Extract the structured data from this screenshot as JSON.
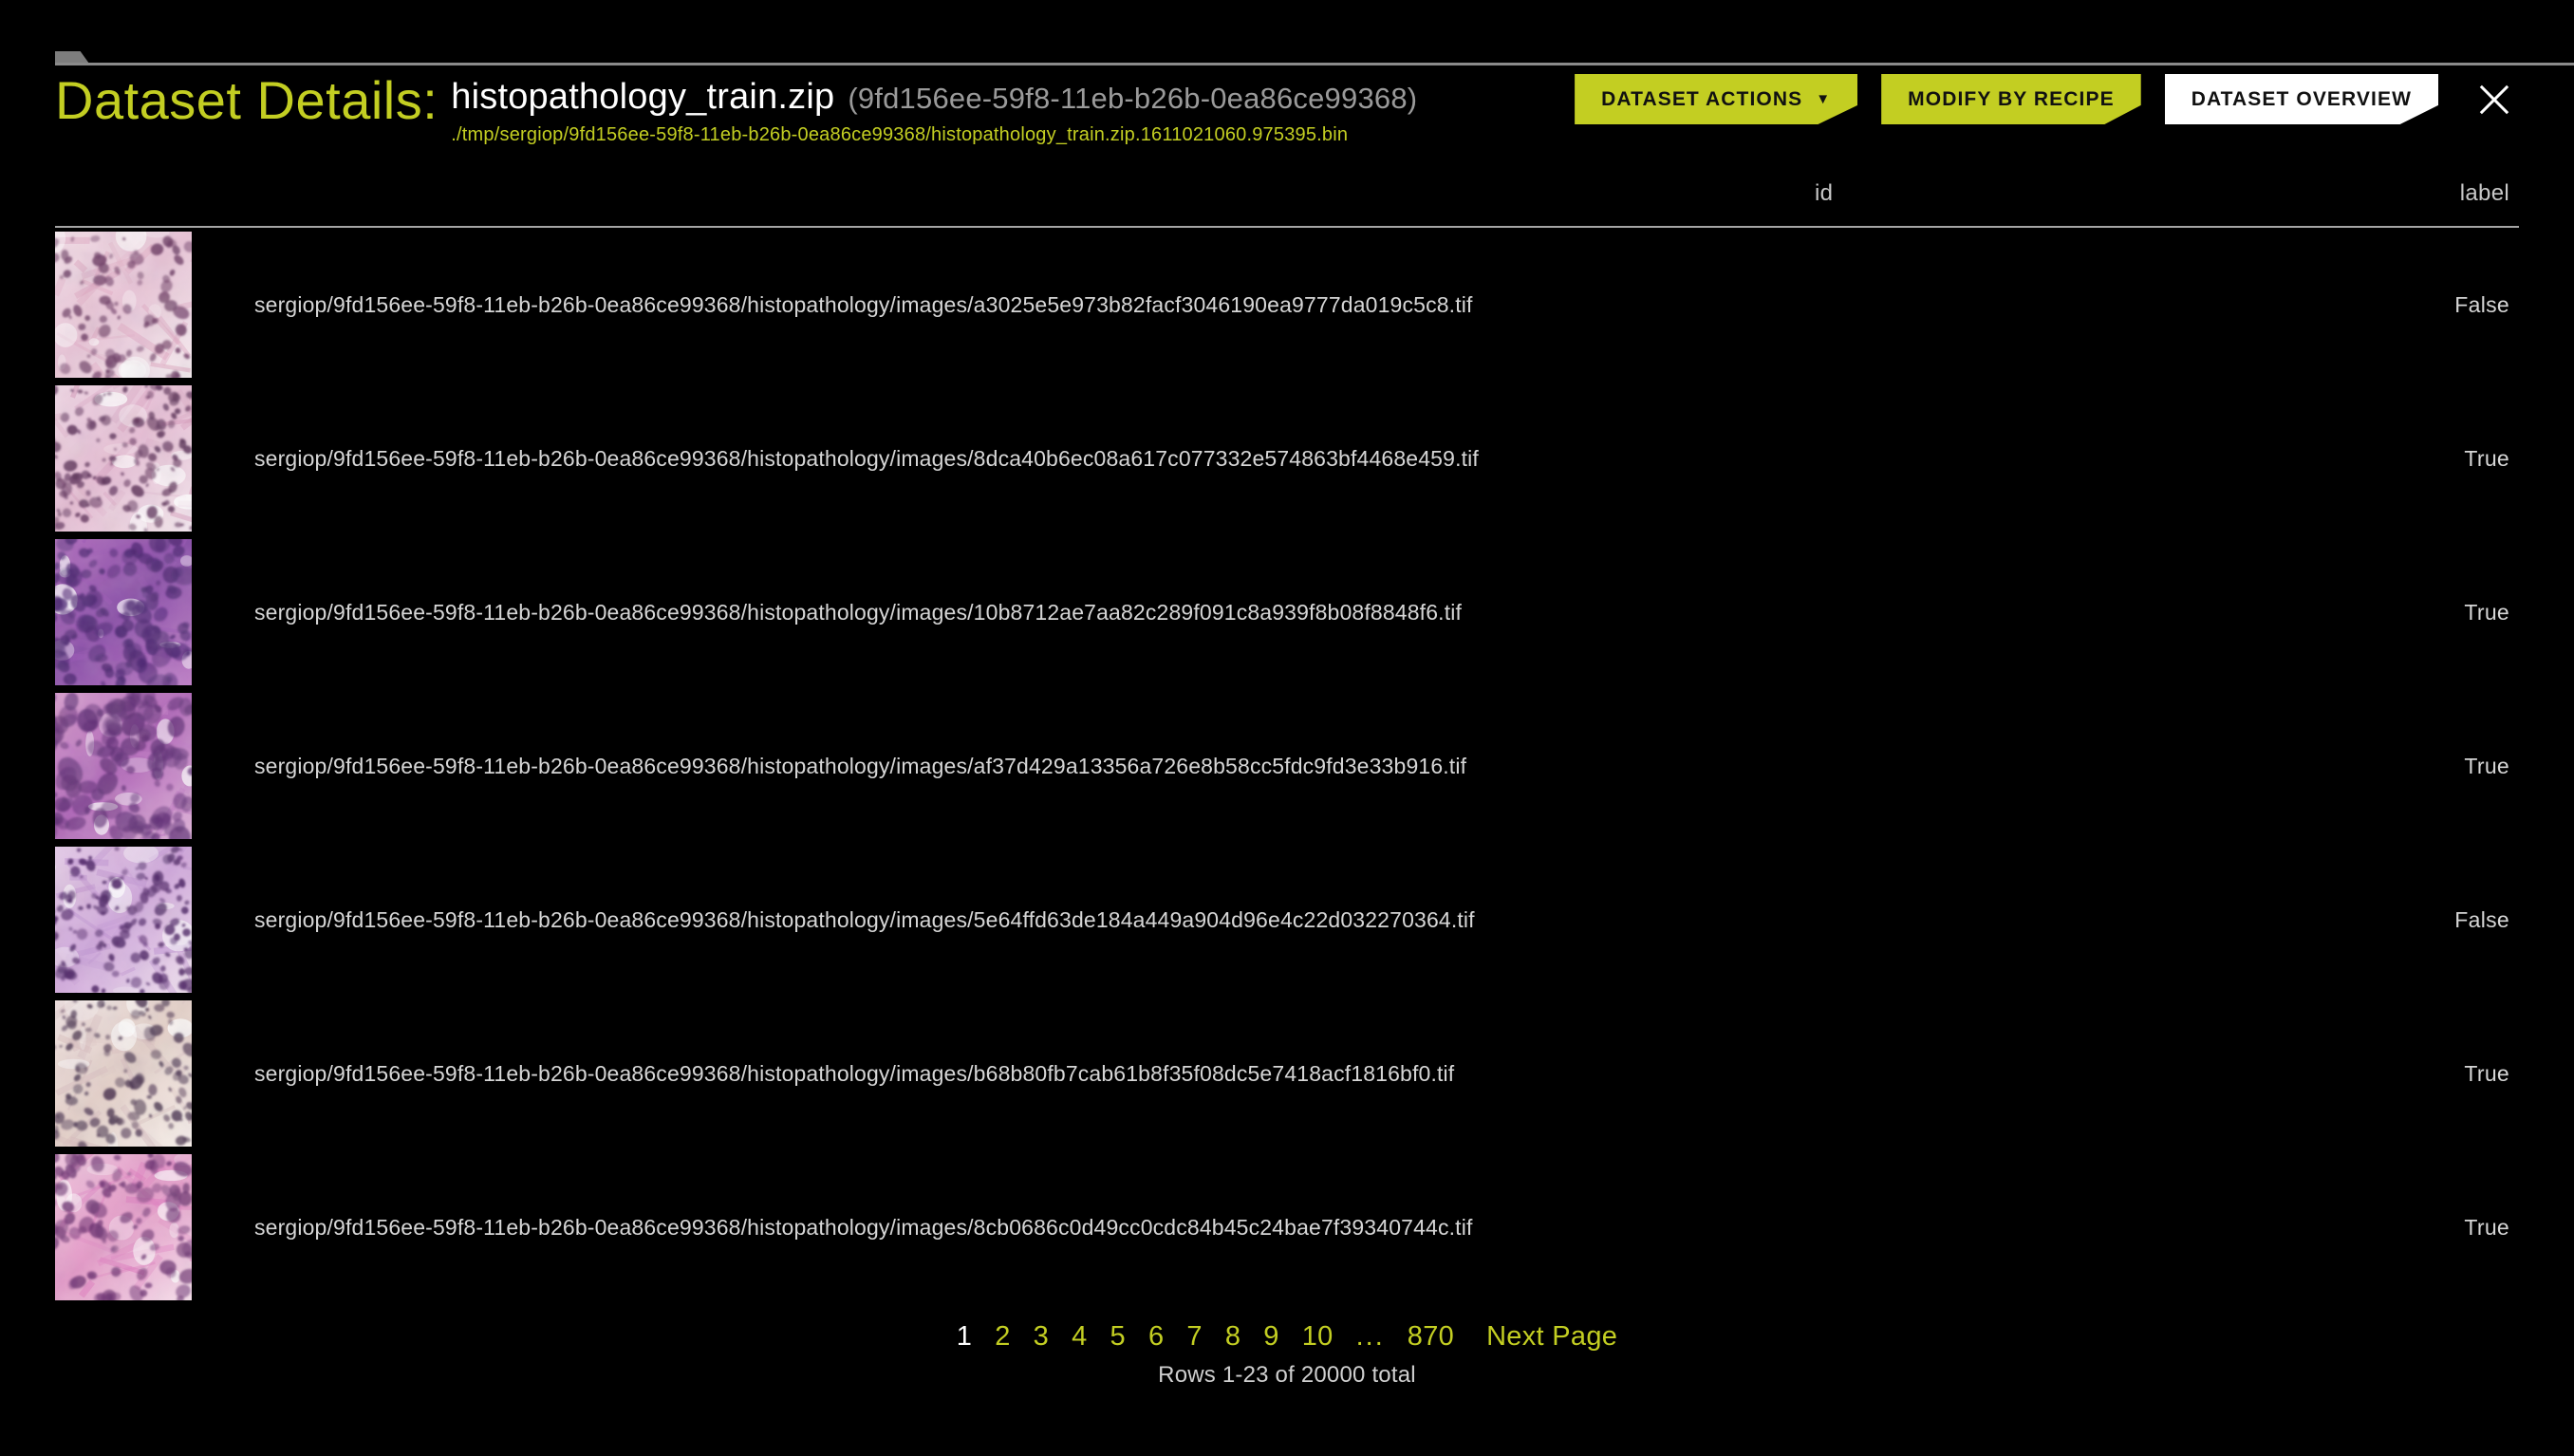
{
  "window": {
    "title_prefix": "Dataset Details:",
    "file_name": "histopathology_train.zip",
    "uuid": "(9fd156ee-59f8-11eb-b26b-0ea86ce99368)",
    "file_path": "./tmp/sergiop/9fd156ee-59f8-11eb-b26b-0ea86ce99368/histopathology_train.zip.1611021060.975395.bin"
  },
  "colors": {
    "accent_yellow": "#c3ce22",
    "background": "#000000",
    "text_primary": "#ffffff",
    "text_secondary": "#d6d6d6",
    "text_muted": "#9a9a9a",
    "button_white": "#ffffff",
    "rule": "#a5a5a5"
  },
  "actions": {
    "dataset_actions_label": "DATASET ACTIONS",
    "dataset_actions_caret": "▼",
    "modify_by_recipe_label": "MODIFY BY RECIPE",
    "dataset_overview_label": "DATASET OVERVIEW",
    "close_label": "×"
  },
  "table": {
    "columns": [
      "id",
      "label"
    ],
    "rows": [
      {
        "id": "sergiop/9fd156ee-59f8-11eb-b26b-0ea86ce99368/histopathology/images/a3025e5e973b82facf3046190ea9777da019c5c8.tif",
        "label": "False",
        "thumb": "histopathology-thumbnail-1"
      },
      {
        "id": "sergiop/9fd156ee-59f8-11eb-b26b-0ea86ce99368/histopathology/images/8dca40b6ec08a617c077332e574863bf4468e459.tif",
        "label": "True",
        "thumb": "histopathology-thumbnail-2"
      },
      {
        "id": "sergiop/9fd156ee-59f8-11eb-b26b-0ea86ce99368/histopathology/images/10b8712ae7aa82c289f091c8a939f8b08f8848f6.tif",
        "label": "True",
        "thumb": "histopathology-thumbnail-3"
      },
      {
        "id": "sergiop/9fd156ee-59f8-11eb-b26b-0ea86ce99368/histopathology/images/af37d429a13356a726e8b58cc5fdc9fd3e33b916.tif",
        "label": "True",
        "thumb": "histopathology-thumbnail-4"
      },
      {
        "id": "sergiop/9fd156ee-59f8-11eb-b26b-0ea86ce99368/histopathology/images/5e64ffd63de184a449a904d96e4c22d032270364.tif",
        "label": "False",
        "thumb": "histopathology-thumbnail-5"
      },
      {
        "id": "sergiop/9fd156ee-59f8-11eb-b26b-0ea86ce99368/histopathology/images/b68b80fb7cab61b8f35f08dc5e7418acf1816bf0.tif",
        "label": "True",
        "thumb": "histopathology-thumbnail-6"
      },
      {
        "id": "sergiop/9fd156ee-59f8-11eb-b26b-0ea86ce99368/histopathology/images/8cb0686c0d49cc0cdc84b45c24bae7f39340744c.tif",
        "label": "True",
        "thumb": "histopathology-thumbnail-7"
      }
    ]
  },
  "pagination": {
    "pages": [
      "1",
      "2",
      "3",
      "4",
      "5",
      "6",
      "7",
      "8",
      "9",
      "10"
    ],
    "current_page": "1",
    "ellipsis": "...",
    "last_page": "870",
    "next_label": "Next Page",
    "rows_total": "Rows 1-23 of 20000 total"
  }
}
